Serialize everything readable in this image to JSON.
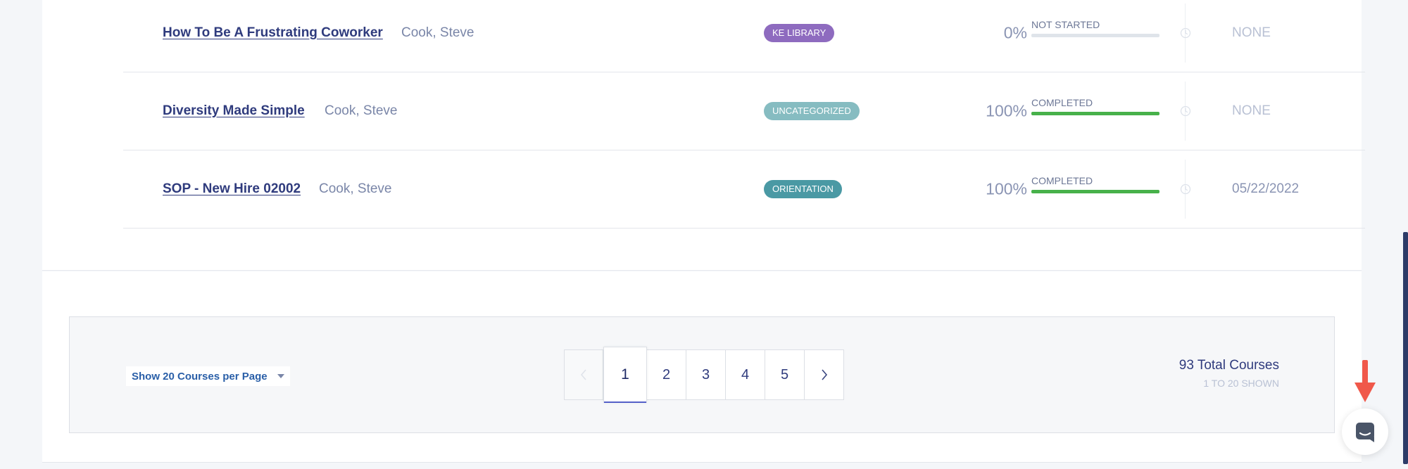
{
  "courses": [
    {
      "title": "How To Be A Frustrating Coworker",
      "author": "Cook, Steve",
      "category": "KE LIBRARY",
      "category_color": "#8e6bbf",
      "percent": "0%",
      "progress": 0,
      "status": "NOT STARTED",
      "due": "NONE"
    },
    {
      "title": "Diversity Made Simple",
      "author": "Cook, Steve",
      "category": "UNCATEGORIZED",
      "category_color": "#86bcc1",
      "percent": "100%",
      "progress": 1,
      "status": "COMPLETED",
      "due": "NONE"
    },
    {
      "title": "SOP - New Hire 02002",
      "author": "Cook, Steve",
      "category": "ORIENTATION",
      "category_color": "#4a99a4",
      "percent": "100%",
      "progress": 1,
      "status": "COMPLETED",
      "due": "05/22/2022"
    }
  ],
  "pagination": {
    "per_page_label": "Show 20 Courses per Page",
    "pages": [
      "1",
      "2",
      "3",
      "4",
      "5"
    ],
    "current_page": "1",
    "prev_icon": "chevron-left-icon",
    "next_icon": "chevron-right-icon",
    "total_label": "93 Total Courses",
    "shown_label": "1 TO 20 SHOWN"
  },
  "colors": {
    "title": "#2f3b7d",
    "link_blue": "#2a5fa8",
    "progress_complete": "#47b14a",
    "arrow": "#f0584a"
  },
  "icons": {
    "due_date": "clock-icon",
    "chat": "chat-icon",
    "annotation": "arrow-down-icon"
  }
}
